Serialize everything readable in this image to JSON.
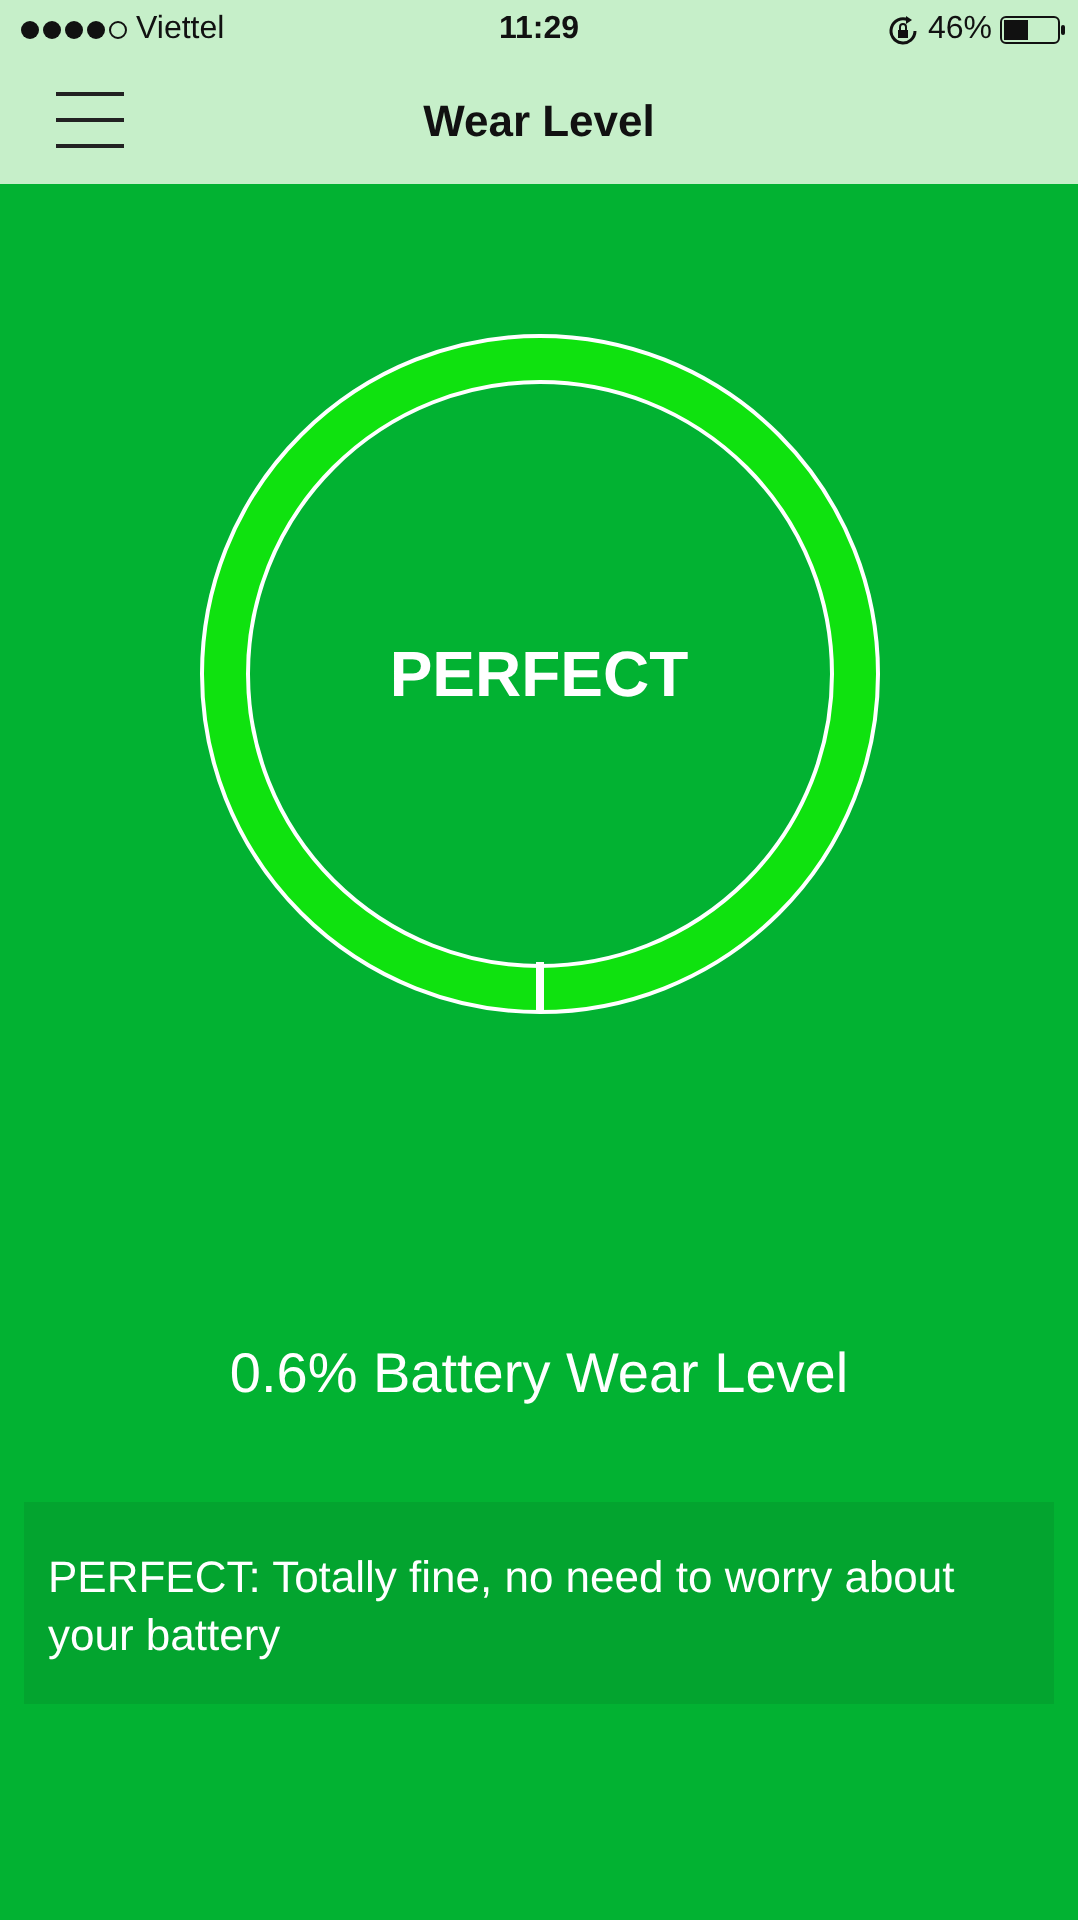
{
  "status_bar": {
    "carrier": "Viettel",
    "time": "11:29",
    "battery": "46%"
  },
  "header": {
    "title": "Wear Level"
  },
  "gauge": {
    "label": "PERFECT"
  },
  "summary": "0.6% Battery Wear Level",
  "note": "PERFECT: Totally fine, no need to worry about your battery"
}
